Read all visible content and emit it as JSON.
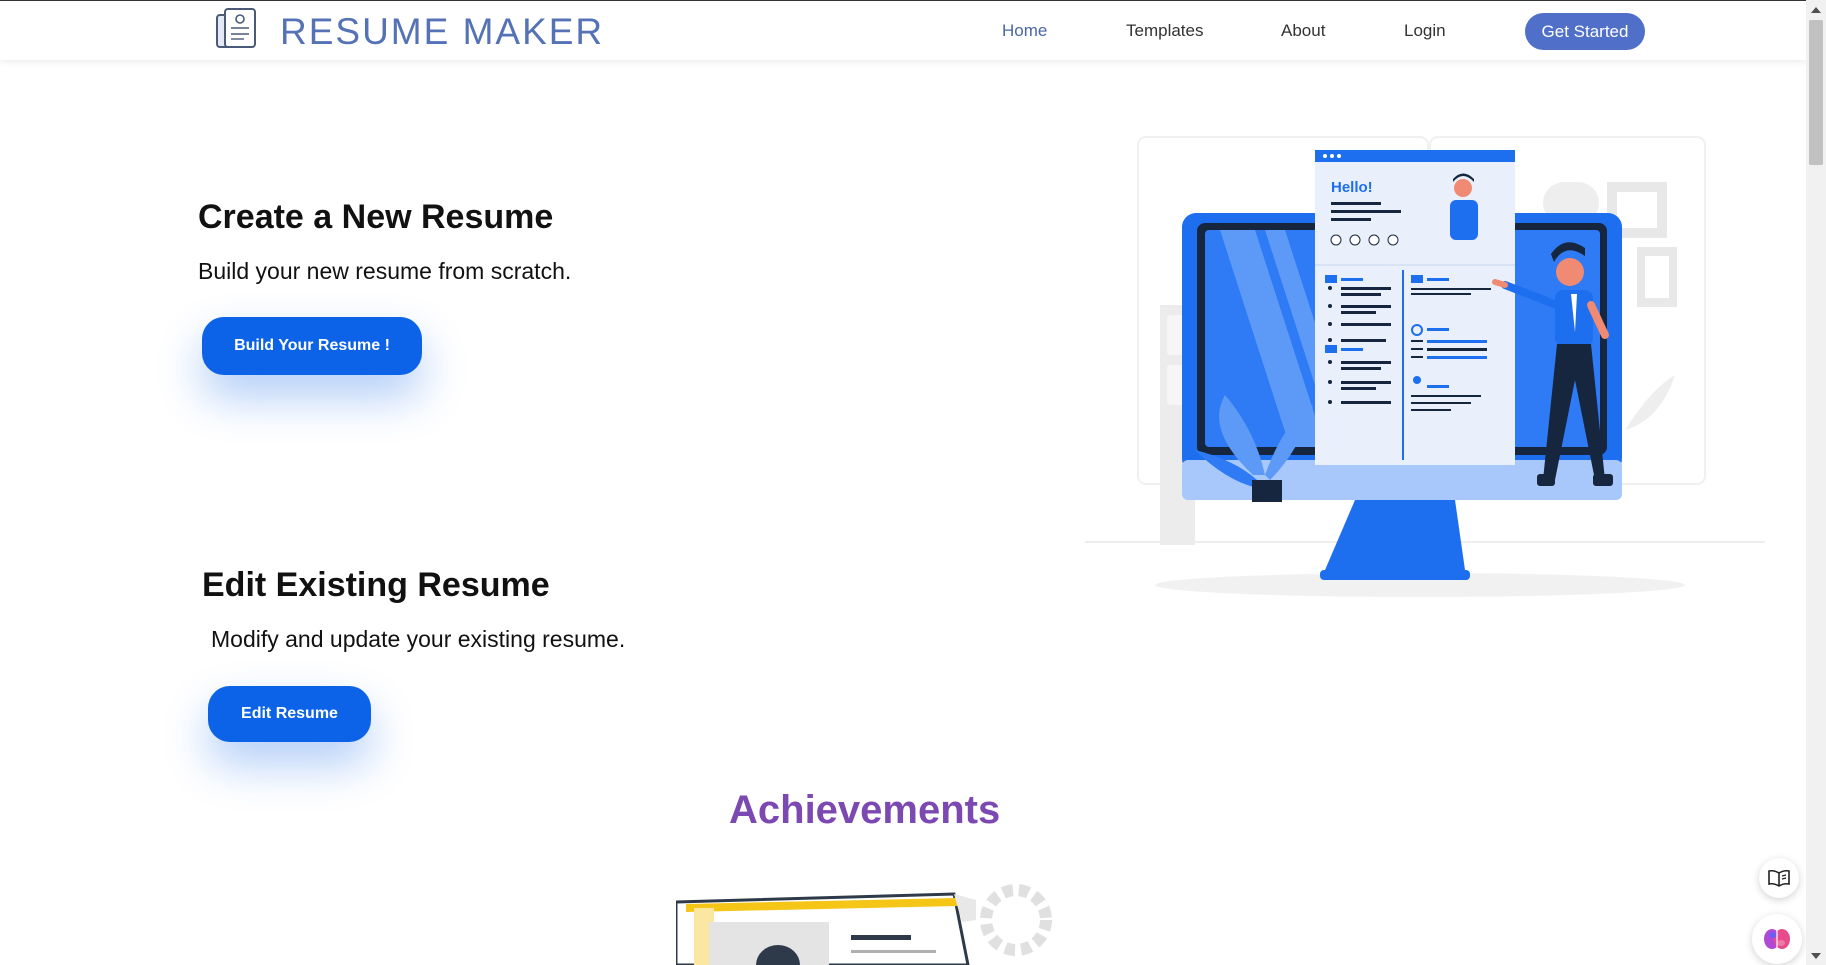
{
  "brand": {
    "name": "RESUME MAKER",
    "logo_icon": "document-icon"
  },
  "nav": {
    "links": [
      {
        "label": "Home",
        "active": true
      },
      {
        "label": "Templates",
        "active": false
      },
      {
        "label": "About",
        "active": false
      },
      {
        "label": "Login",
        "active": false
      }
    ],
    "cta_label": "Get Started"
  },
  "create_section": {
    "title": "Create a New Resume",
    "description": "Build your new resume from scratch.",
    "button_label": "Build Your Resume !"
  },
  "edit_section": {
    "title": "Edit Existing Resume",
    "description": "Modify and update your existing resume.",
    "button_label": "Edit Resume"
  },
  "achievements_title": "Achievements",
  "illustration": {
    "greeting": "Hello!"
  },
  "colors": {
    "primary": "#0d63e8",
    "brand": "#5472b5",
    "accent": "#7c49b3",
    "nav_active": "#4a66a8"
  },
  "floating_widgets": [
    "book-icon",
    "brain-icon"
  ]
}
